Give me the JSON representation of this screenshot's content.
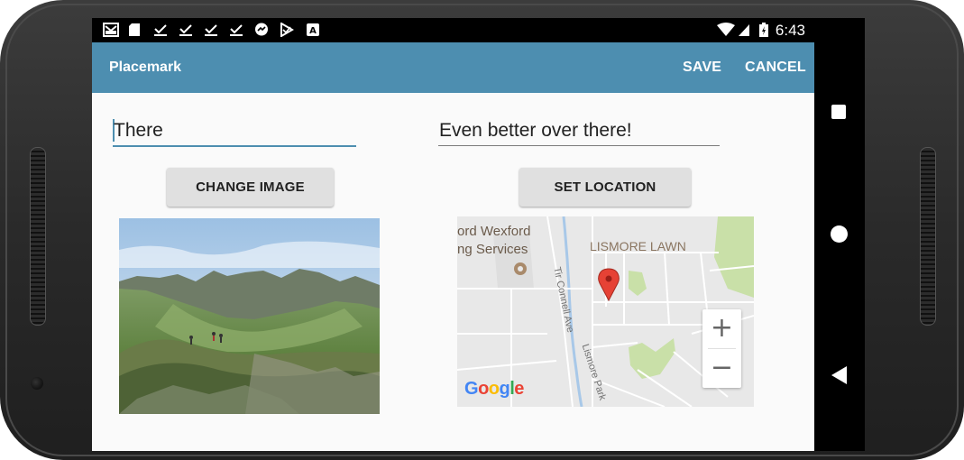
{
  "status_bar": {
    "time": "6:43",
    "notification_icons": [
      "gmail-icon",
      "sd-card-icon",
      "check-icon",
      "check-icon",
      "check-icon",
      "check-icon",
      "messenger-icon",
      "play-icon",
      "a-icon"
    ],
    "system_icons": [
      "wifi-icon",
      "signal-icon",
      "battery-icon"
    ]
  },
  "app_bar": {
    "title": "Placemark",
    "save_label": "SAVE",
    "cancel_label": "CANCEL",
    "color": "#4d8eb0"
  },
  "form": {
    "title_value": "There",
    "description_value": "Even better over there!",
    "change_image_label": "CHANGE IMAGE",
    "set_location_label": "SET LOCATION"
  },
  "map": {
    "place_line1": "ord Wexford",
    "place_line2": "ng Services",
    "area_label": "LISMORE LAWN",
    "street1": "Tir Connell Ave",
    "street2": "Lismore Park",
    "zoom_in": "+",
    "zoom_out": "−",
    "attribution": [
      "G",
      "o",
      "o",
      "g",
      "l",
      "e"
    ]
  },
  "nav_bar": {
    "buttons": [
      "recents-icon",
      "home-icon",
      "back-icon"
    ]
  }
}
